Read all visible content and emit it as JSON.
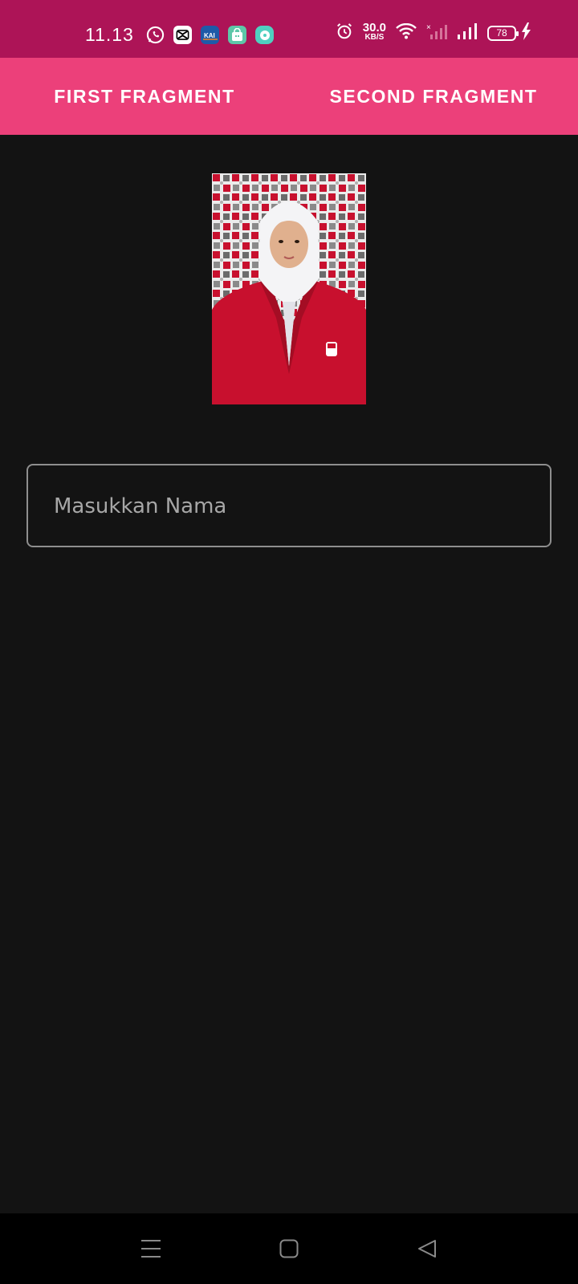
{
  "status_bar": {
    "time": "11.13",
    "notification_icons": [
      "whatsapp-icon",
      "capcut-icon",
      "kai-access-icon",
      "shopee-icon",
      "messenger-icon"
    ],
    "net_speed_value": "30.0",
    "net_speed_unit": "KB/S",
    "battery_level": "78"
  },
  "tabs": [
    {
      "label": "FIRST FRAGMENT"
    },
    {
      "label": "SECOND FRAGMENT"
    }
  ],
  "profile_photo": {
    "description_icon": "portrait-photo"
  },
  "name_input": {
    "placeholder": "Masukkan Nama",
    "value": ""
  },
  "nav_bar": {
    "icons": [
      "menu-icon",
      "home-icon",
      "back-icon"
    ]
  },
  "colors": {
    "status_bar": "#ad1457",
    "toolbar": "#ec407a",
    "background": "#131313",
    "jacket_red": "#c8102e"
  }
}
